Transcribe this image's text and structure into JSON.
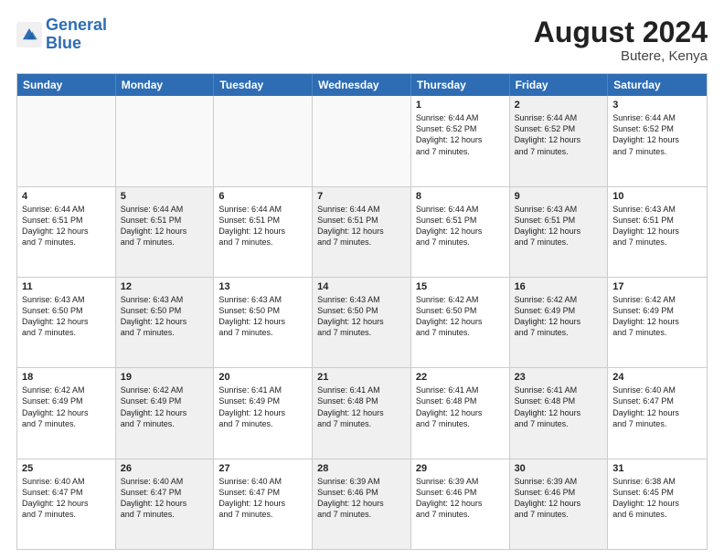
{
  "header": {
    "logo_line1": "General",
    "logo_line2": "Blue",
    "month_year": "August 2024",
    "location": "Butere, Kenya"
  },
  "weekdays": [
    "Sunday",
    "Monday",
    "Tuesday",
    "Wednesday",
    "Thursday",
    "Friday",
    "Saturday"
  ],
  "rows": [
    [
      {
        "day": "",
        "info": "",
        "shaded": false,
        "empty": true
      },
      {
        "day": "",
        "info": "",
        "shaded": false,
        "empty": true
      },
      {
        "day": "",
        "info": "",
        "shaded": false,
        "empty": true
      },
      {
        "day": "",
        "info": "",
        "shaded": false,
        "empty": true
      },
      {
        "day": "1",
        "info": "Sunrise: 6:44 AM\nSunset: 6:52 PM\nDaylight: 12 hours\nand 7 minutes.",
        "shaded": false,
        "empty": false
      },
      {
        "day": "2",
        "info": "Sunrise: 6:44 AM\nSunset: 6:52 PM\nDaylight: 12 hours\nand 7 minutes.",
        "shaded": true,
        "empty": false
      },
      {
        "day": "3",
        "info": "Sunrise: 6:44 AM\nSunset: 6:52 PM\nDaylight: 12 hours\nand 7 minutes.",
        "shaded": false,
        "empty": false
      }
    ],
    [
      {
        "day": "4",
        "info": "Sunrise: 6:44 AM\nSunset: 6:51 PM\nDaylight: 12 hours\nand 7 minutes.",
        "shaded": false,
        "empty": false
      },
      {
        "day": "5",
        "info": "Sunrise: 6:44 AM\nSunset: 6:51 PM\nDaylight: 12 hours\nand 7 minutes.",
        "shaded": true,
        "empty": false
      },
      {
        "day": "6",
        "info": "Sunrise: 6:44 AM\nSunset: 6:51 PM\nDaylight: 12 hours\nand 7 minutes.",
        "shaded": false,
        "empty": false
      },
      {
        "day": "7",
        "info": "Sunrise: 6:44 AM\nSunset: 6:51 PM\nDaylight: 12 hours\nand 7 minutes.",
        "shaded": true,
        "empty": false
      },
      {
        "day": "8",
        "info": "Sunrise: 6:44 AM\nSunset: 6:51 PM\nDaylight: 12 hours\nand 7 minutes.",
        "shaded": false,
        "empty": false
      },
      {
        "day": "9",
        "info": "Sunrise: 6:43 AM\nSunset: 6:51 PM\nDaylight: 12 hours\nand 7 minutes.",
        "shaded": true,
        "empty": false
      },
      {
        "day": "10",
        "info": "Sunrise: 6:43 AM\nSunset: 6:51 PM\nDaylight: 12 hours\nand 7 minutes.",
        "shaded": false,
        "empty": false
      }
    ],
    [
      {
        "day": "11",
        "info": "Sunrise: 6:43 AM\nSunset: 6:50 PM\nDaylight: 12 hours\nand 7 minutes.",
        "shaded": false,
        "empty": false
      },
      {
        "day": "12",
        "info": "Sunrise: 6:43 AM\nSunset: 6:50 PM\nDaylight: 12 hours\nand 7 minutes.",
        "shaded": true,
        "empty": false
      },
      {
        "day": "13",
        "info": "Sunrise: 6:43 AM\nSunset: 6:50 PM\nDaylight: 12 hours\nand 7 minutes.",
        "shaded": false,
        "empty": false
      },
      {
        "day": "14",
        "info": "Sunrise: 6:43 AM\nSunset: 6:50 PM\nDaylight: 12 hours\nand 7 minutes.",
        "shaded": true,
        "empty": false
      },
      {
        "day": "15",
        "info": "Sunrise: 6:42 AM\nSunset: 6:50 PM\nDaylight: 12 hours\nand 7 minutes.",
        "shaded": false,
        "empty": false
      },
      {
        "day": "16",
        "info": "Sunrise: 6:42 AM\nSunset: 6:49 PM\nDaylight: 12 hours\nand 7 minutes.",
        "shaded": true,
        "empty": false
      },
      {
        "day": "17",
        "info": "Sunrise: 6:42 AM\nSunset: 6:49 PM\nDaylight: 12 hours\nand 7 minutes.",
        "shaded": false,
        "empty": false
      }
    ],
    [
      {
        "day": "18",
        "info": "Sunrise: 6:42 AM\nSunset: 6:49 PM\nDaylight: 12 hours\nand 7 minutes.",
        "shaded": false,
        "empty": false
      },
      {
        "day": "19",
        "info": "Sunrise: 6:42 AM\nSunset: 6:49 PM\nDaylight: 12 hours\nand 7 minutes.",
        "shaded": true,
        "empty": false
      },
      {
        "day": "20",
        "info": "Sunrise: 6:41 AM\nSunset: 6:49 PM\nDaylight: 12 hours\nand 7 minutes.",
        "shaded": false,
        "empty": false
      },
      {
        "day": "21",
        "info": "Sunrise: 6:41 AM\nSunset: 6:48 PM\nDaylight: 12 hours\nand 7 minutes.",
        "shaded": true,
        "empty": false
      },
      {
        "day": "22",
        "info": "Sunrise: 6:41 AM\nSunset: 6:48 PM\nDaylight: 12 hours\nand 7 minutes.",
        "shaded": false,
        "empty": false
      },
      {
        "day": "23",
        "info": "Sunrise: 6:41 AM\nSunset: 6:48 PM\nDaylight: 12 hours\nand 7 minutes.",
        "shaded": true,
        "empty": false
      },
      {
        "day": "24",
        "info": "Sunrise: 6:40 AM\nSunset: 6:47 PM\nDaylight: 12 hours\nand 7 minutes.",
        "shaded": false,
        "empty": false
      }
    ],
    [
      {
        "day": "25",
        "info": "Sunrise: 6:40 AM\nSunset: 6:47 PM\nDaylight: 12 hours\nand 7 minutes.",
        "shaded": false,
        "empty": false
      },
      {
        "day": "26",
        "info": "Sunrise: 6:40 AM\nSunset: 6:47 PM\nDaylight: 12 hours\nand 7 minutes.",
        "shaded": true,
        "empty": false
      },
      {
        "day": "27",
        "info": "Sunrise: 6:40 AM\nSunset: 6:47 PM\nDaylight: 12 hours\nand 7 minutes.",
        "shaded": false,
        "empty": false
      },
      {
        "day": "28",
        "info": "Sunrise: 6:39 AM\nSunset: 6:46 PM\nDaylight: 12 hours\nand 7 minutes.",
        "shaded": true,
        "empty": false
      },
      {
        "day": "29",
        "info": "Sunrise: 6:39 AM\nSunset: 6:46 PM\nDaylight: 12 hours\nand 7 minutes.",
        "shaded": false,
        "empty": false
      },
      {
        "day": "30",
        "info": "Sunrise: 6:39 AM\nSunset: 6:46 PM\nDaylight: 12 hours\nand 7 minutes.",
        "shaded": true,
        "empty": false
      },
      {
        "day": "31",
        "info": "Sunrise: 6:38 AM\nSunset: 6:45 PM\nDaylight: 12 hours\nand 6 minutes.",
        "shaded": false,
        "empty": false
      }
    ]
  ]
}
